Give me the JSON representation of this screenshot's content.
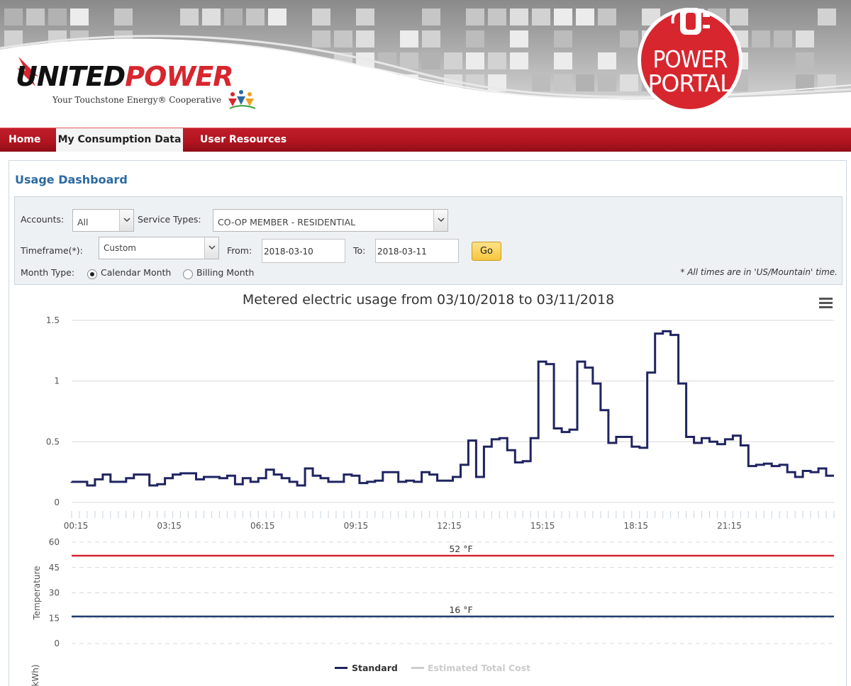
{
  "brand": {
    "logo_united": "UNITED",
    "logo_power": "POWER",
    "tagline": "Your Touchstone Energy® Cooperative",
    "badge_line1": "POWER",
    "badge_line2": "PORTAL",
    "colors": {
      "brand_red": "#d7262e",
      "nav_red": "#b0141f",
      "title_blue": "#2b6aa1"
    }
  },
  "nav": {
    "home": "Home",
    "consumption": "My Consumption Data",
    "resources": "User Resources"
  },
  "dashboard": {
    "title": "Usage Dashboard",
    "filters": {
      "accounts_label": "Accounts:",
      "accounts_value": "All",
      "service_types_label": "Service Types:",
      "service_types_value": "CO-OP MEMBER - RESIDENTIAL",
      "timeframe_label": "Timeframe(*):",
      "timeframe_value": "Custom",
      "from_label": "From:",
      "from_value": "2018-03-10",
      "to_label": "To:",
      "to_value": "2018-03-11",
      "go_label": "Go",
      "month_type_label": "Month Type:",
      "calendar_month": "Calendar Month",
      "billing_month": "Billing Month",
      "month_type_selected": "Calendar Month",
      "timezone_note": "* All times are in 'US/Mountain' time."
    }
  },
  "menu_icon": "hamburger-menu-icon",
  "chart_data": [
    {
      "type": "line",
      "step": true,
      "title": "Metered electric usage from 03/10/2018 to 03/11/2018",
      "ylabel": "Usage (kWh)",
      "ylim": [
        0,
        1.5
      ],
      "yticks": [
        "0",
        "0.5",
        "1",
        "1.5"
      ],
      "xtick_labels": [
        "00:15",
        "03:15",
        "06:15",
        "09:15",
        "12:15",
        "15:15",
        "18:15",
        "21:15"
      ],
      "interval_minutes": 15,
      "grid": true,
      "series": [
        {
          "name": "Standard",
          "color": "#1f2460",
          "values": [
            0.17,
            0.17,
            0.14,
            0.19,
            0.23,
            0.17,
            0.17,
            0.2,
            0.23,
            0.23,
            0.14,
            0.15,
            0.2,
            0.23,
            0.24,
            0.24,
            0.19,
            0.21,
            0.21,
            0.2,
            0.22,
            0.15,
            0.2,
            0.17,
            0.2,
            0.27,
            0.23,
            0.2,
            0.17,
            0.14,
            0.28,
            0.22,
            0.2,
            0.17,
            0.17,
            0.23,
            0.22,
            0.16,
            0.17,
            0.18,
            0.25,
            0.25,
            0.17,
            0.18,
            0.17,
            0.25,
            0.23,
            0.18,
            0.18,
            0.21,
            0.31,
            0.51,
            0.21,
            0.46,
            0.52,
            0.53,
            0.43,
            0.33,
            0.34,
            0.53,
            1.16,
            1.14,
            0.61,
            0.58,
            0.6,
            1.16,
            1.11,
            0.98,
            0.76,
            0.49,
            0.54,
            0.54,
            0.46,
            0.45,
            1.07,
            1.39,
            1.41,
            1.38,
            0.98,
            0.54,
            0.49,
            0.53,
            0.5,
            0.48,
            0.52,
            0.55,
            0.47,
            0.3,
            0.31,
            0.32,
            0.3,
            0.31,
            0.25,
            0.21,
            0.26,
            0.25,
            0.28,
            0.22
          ]
        },
        {
          "name": "Estimated Total Cost",
          "color": "#cccccc",
          "values": []
        }
      ]
    },
    {
      "type": "line",
      "ylabel": "Temperature",
      "ylim": [
        0,
        60
      ],
      "yticks": [
        "0",
        "15",
        "30",
        "45",
        "60"
      ],
      "grid": true,
      "series": [
        {
          "color": "#d7262e",
          "values": [
            52
          ],
          "label": "52 °F"
        },
        {
          "color": "#1f3a6e",
          "values": [
            16
          ],
          "label": "16 °F"
        }
      ]
    }
  ],
  "legend": {
    "standard": "Standard",
    "estimated_cost": "Estimated Total Cost"
  }
}
